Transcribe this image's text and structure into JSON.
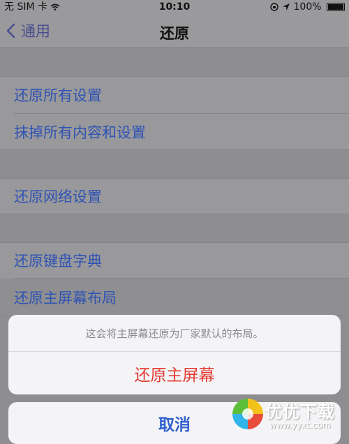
{
  "status_bar": {
    "carrier": "无 SIM 卡",
    "time": "10:10",
    "battery": "100%",
    "icons": [
      "wifi-icon",
      "orientation-lock-icon",
      "location-icon",
      "battery-icon"
    ]
  },
  "nav": {
    "back_label": "通用",
    "title": "还原"
  },
  "settings": {
    "items": [
      {
        "label": "还原所有设置"
      },
      {
        "label": "抹掉所有内容和设置"
      },
      {
        "label": "还原网络设置"
      },
      {
        "label": "还原键盘字典"
      },
      {
        "label": "还原主屏幕布局"
      }
    ]
  },
  "action_sheet": {
    "message": "这会将主屏幕还原为厂家默认的布局。",
    "confirm_label": "还原主屏幕",
    "cancel_label": "取消"
  },
  "watermark": {
    "brand": "优优下载",
    "url": "www.yyxt.com"
  },
  "colors": {
    "link": "#2f53b3",
    "destructive": "#e53b33",
    "cancel": "#3060d0",
    "dim_background": "#8e8e91"
  }
}
